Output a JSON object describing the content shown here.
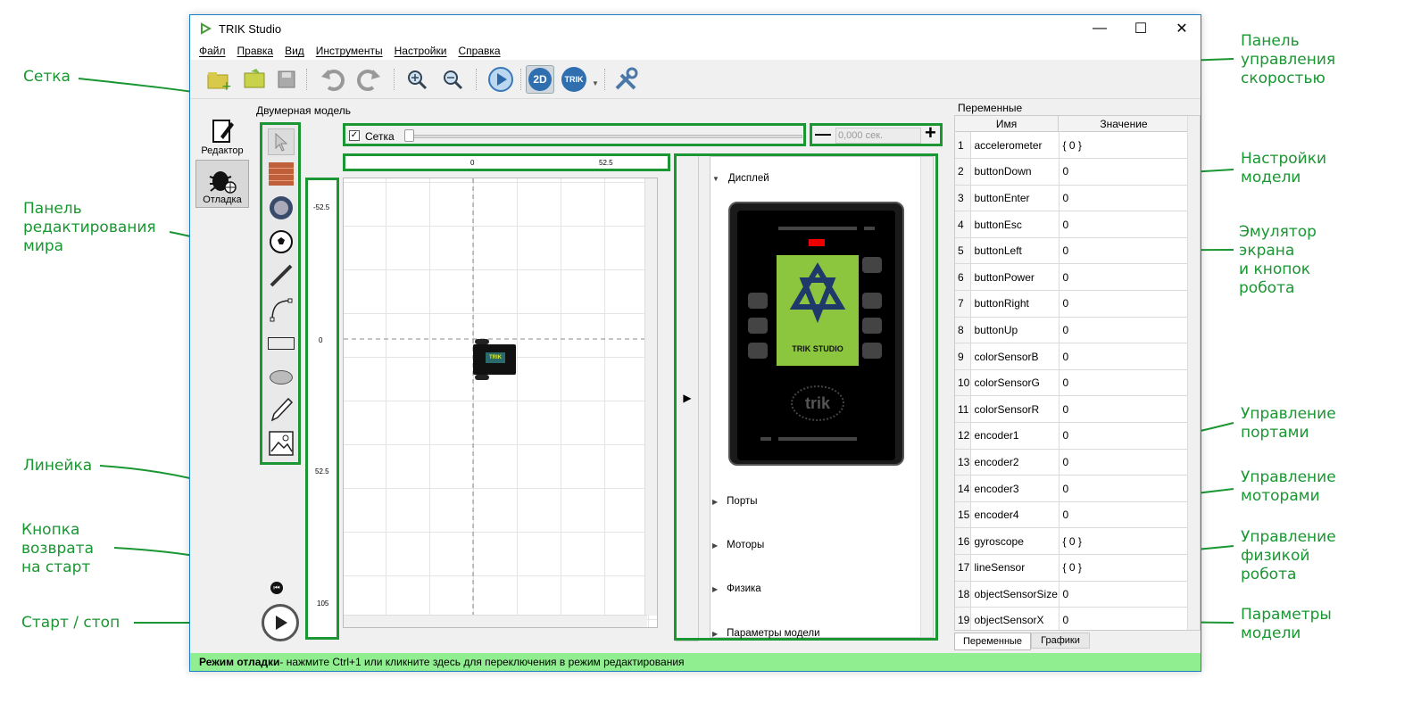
{
  "window": {
    "title": "TRIK Studio",
    "minimize": "—",
    "maximize": "☐",
    "close": "✕"
  },
  "menu": [
    "Файл",
    "Правка",
    "Вид",
    "Инструменты",
    "Настройки",
    "Справка"
  ],
  "toolbar": {
    "mode_2d": "2D",
    "trik_label": "TRIK"
  },
  "modes": [
    {
      "label": "Редактор"
    },
    {
      "label": "Отладка"
    }
  ],
  "panel_titles": {
    "model": "Двумерная модель",
    "variables": "Переменные"
  },
  "grid": {
    "label": "Сетка",
    "checked": true
  },
  "speed": {
    "minus": "—",
    "value_placeholder": "0,000 сек.",
    "plus": "+"
  },
  "ruler": {
    "x_labels": [
      "0",
      "52.5"
    ],
    "y_labels": [
      "-52.5",
      "0",
      "52.5",
      "105"
    ]
  },
  "settings_sections": [
    "Дисплей",
    "Порты",
    "Моторы",
    "Физика",
    "Параметры модели"
  ],
  "robot_screen": {
    "brand": "TRIK STUDIO",
    "logo_text": "trik"
  },
  "variables": {
    "headers": [
      "Имя",
      "Значение"
    ],
    "rows": [
      [
        "1",
        "accelerometer",
        "{ 0 }"
      ],
      [
        "2",
        "buttonDown",
        "0"
      ],
      [
        "3",
        "buttonEnter",
        "0"
      ],
      [
        "4",
        "buttonEsc",
        "0"
      ],
      [
        "5",
        "buttonLeft",
        "0"
      ],
      [
        "6",
        "buttonPower",
        "0"
      ],
      [
        "7",
        "buttonRight",
        "0"
      ],
      [
        "8",
        "buttonUp",
        "0"
      ],
      [
        "9",
        "colorSensorB",
        "0"
      ],
      [
        "10",
        "colorSensorG",
        "0"
      ],
      [
        "11",
        "colorSensorR",
        "0"
      ],
      [
        "12",
        "encoder1",
        "0"
      ],
      [
        "13",
        "encoder2",
        "0"
      ],
      [
        "14",
        "encoder3",
        "0"
      ],
      [
        "15",
        "encoder4",
        "0"
      ],
      [
        "16",
        "gyroscope",
        "{ 0 }"
      ],
      [
        "17",
        "lineSensor",
        "{ 0 }"
      ],
      [
        "18",
        "objectSensorSize",
        "0"
      ],
      [
        "19",
        "objectSensorX",
        "0"
      ]
    ],
    "tabs": [
      "Переменные",
      "Графики"
    ]
  },
  "status": {
    "bold": "Режим отладки",
    "text": " - нажмите Ctrl+1 или кликните здесь для переключения в режим редактирования"
  },
  "annotations": {
    "grid": "Сетка",
    "palette": "Панель\nредактирования\nмира",
    "ruler": "Линейка",
    "return": "Кнопка\nвозврата\nна старт",
    "startstop": "Старт / стоп",
    "speed": "Панель\nуправления\nскоростью",
    "model_settings": "Настройки\nмодели",
    "emulator": "Эмулятор\nэкрана\nи кнопок\nробота",
    "ports": "Управление\nпортами",
    "motors": "Управление\nмоторами",
    "physics": "Управление\nфизикой\nробота",
    "params": "Параметры\nмодели"
  },
  "colors": {
    "accent": "#1a9632",
    "status_bg": "#90ee90",
    "trik_green": "#8cc63f"
  }
}
